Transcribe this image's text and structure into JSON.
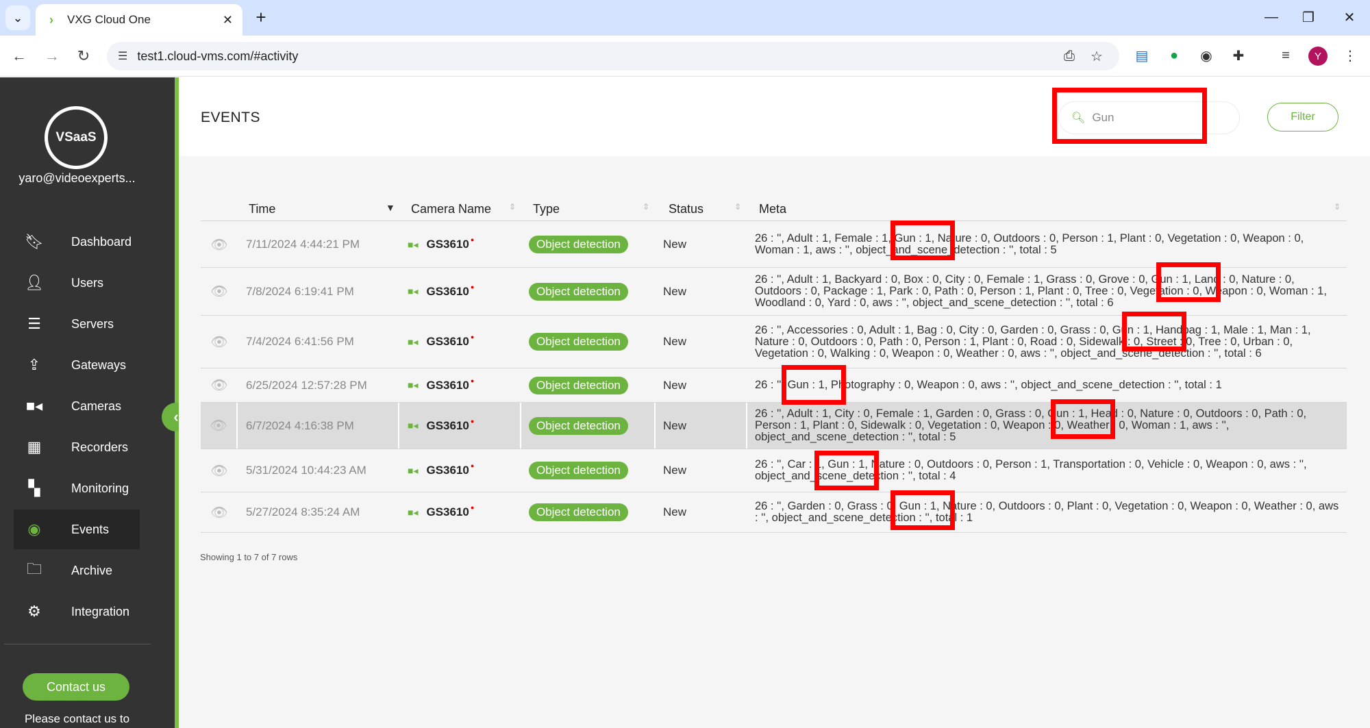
{
  "browser": {
    "tab_title": "VXG Cloud One",
    "url": "test1.cloud-vms.com/#activity",
    "avatar_letter": "Y"
  },
  "sidebar": {
    "logo_text": "VSaaS",
    "user_email": "yaro@videoexperts...",
    "items": [
      {
        "label": "Dashboard",
        "icon": "bookmark-icon",
        "active": false
      },
      {
        "label": "Users",
        "icon": "user-icon",
        "active": false
      },
      {
        "label": "Servers",
        "icon": "server-icon",
        "active": false
      },
      {
        "label": "Gateways",
        "icon": "upload-icon",
        "active": false
      },
      {
        "label": "Cameras",
        "icon": "video-camera-icon",
        "active": false
      },
      {
        "label": "Recorders",
        "icon": "recorder-icon",
        "active": false
      },
      {
        "label": "Monitoring",
        "icon": "grid-icon",
        "active": false
      },
      {
        "label": "Events",
        "icon": "eye-icon",
        "active": true
      },
      {
        "label": "Archive",
        "icon": "folder-icon",
        "active": false
      },
      {
        "label": "Integration",
        "icon": "gears-icon",
        "active": false
      }
    ],
    "contact_label": "Contact us",
    "contact_text": "Please contact us to"
  },
  "header": {
    "title": "EVENTS",
    "search_value": "Gun",
    "filter_label": "Filter"
  },
  "table": {
    "columns": [
      "Time",
      "Camera Name",
      "Type",
      "Status",
      "Meta"
    ],
    "rows": [
      {
        "time": "7/11/2024 4:44:21 PM",
        "camera": "GS3610",
        "type": "Object detection",
        "status": "New",
        "meta": "26 : '', Adult : 1, Female : 1, Gun : 1, Nature : 0, Outdoors : 0, Person : 1, Plant : 0, Vegetation : 0, Weapon : 0, Woman : 1, aws : '', object_and_scene_detection : '', total : 5"
      },
      {
        "time": "7/8/2024 6:19:41 PM",
        "camera": "GS3610",
        "type": "Object detection",
        "status": "New",
        "meta": "26 : '', Adult : 1, Backyard : 0, Box : 0, City : 0, Female : 1, Grass : 0, Grove : 0, Gun : 1, Land : 0, Nature : 0, Outdoors : 0, Package : 1, Park : 0, Path : 0, Person : 1, Plant : 0, Tree : 0, Vegetation : 0, Weapon : 0, Woman : 1, Woodland : 0, Yard : 0, aws : '', object_and_scene_detection : '', total : 6"
      },
      {
        "time": "7/4/2024 6:41:56 PM",
        "camera": "GS3610",
        "type": "Object detection",
        "status": "New",
        "meta": "26 : '', Accessories : 0, Adult : 1, Bag : 0, City : 0, Garden : 0, Grass : 0, Gun : 1, Handbag : 1, Male : 1, Man : 1, Nature : 0, Outdoors : 0, Path : 0, Person : 1, Plant : 0, Road : 0, Sidewalk : 0, Street : 0, Tree : 0, Urban : 0, Vegetation : 0, Walking : 0, Weapon : 0, Weather : 0, aws : '', object_and_scene_detection : '', total : 6"
      },
      {
        "time": "6/25/2024 12:57:28 PM",
        "camera": "GS3610",
        "type": "Object detection",
        "status": "New",
        "meta": "26 : '', Gun : 1, Photography : 0, Weapon : 0, aws : '', object_and_scene_detection : '', total : 1"
      },
      {
        "time": "6/7/2024 4:16:38 PM",
        "camera": "GS3610",
        "type": "Object detection",
        "status": "New",
        "meta": "26 : '', Adult : 1, City : 0, Female : 1, Garden : 0, Grass : 0, Gun : 1, Head : 0, Nature : 0, Outdoors : 0, Path : 0, Person : 1, Plant : 0, Sidewalk : 0, Vegetation : 0, Weapon : 0, Weather : 0, Woman : 1, aws : '', object_and_scene_detection : '', total : 5"
      },
      {
        "time": "5/31/2024 10:44:23 AM",
        "camera": "GS3610",
        "type": "Object detection",
        "status": "New",
        "meta": "26 : '', Car : 1, Gun : 1, Nature : 0, Outdoors : 0, Person : 1, Transportation : 0, Vehicle : 0, Weapon : 0, aws : '', object_and_scene_detection : '', total : 4"
      },
      {
        "time": "5/27/2024 8:35:24 AM",
        "camera": "GS3610",
        "type": "Object detection",
        "status": "New",
        "meta": "26 : '', Garden : 0, Grass : 0, Gun : 1, Nature : 0, Outdoors : 0, Plant : 0, Vegetation : 0, Weapon : 0, Weather : 0, aws : '', object_and_scene_detection : '', total : 1"
      }
    ],
    "footer": "Showing 1 to 7 of 7 rows"
  },
  "colors": {
    "accent": "#6db33f",
    "highlight": "#ff0000",
    "sidebar": "#333333"
  }
}
